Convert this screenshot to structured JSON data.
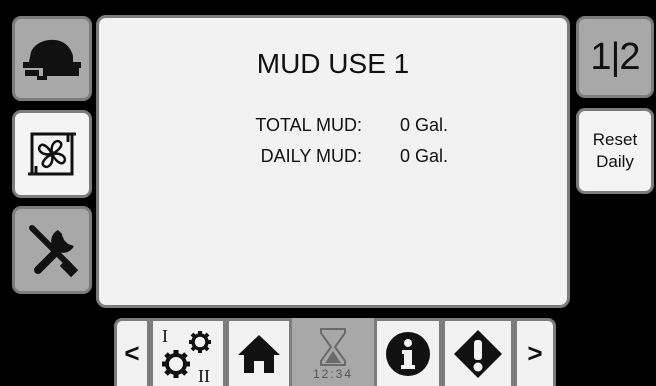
{
  "screen": {
    "title": "MUD USE 1",
    "rows": [
      {
        "label": "TOTAL MUD:",
        "value": "0 Gal."
      },
      {
        "label": "DAILY MUD:",
        "value": "0 Gal."
      }
    ]
  },
  "left_sidebar": {
    "items": [
      {
        "name": "machine-icon"
      },
      {
        "name": "fan-icon"
      },
      {
        "name": "tools-icon"
      }
    ]
  },
  "right_sidebar": {
    "page_indicator": "1|2",
    "reset_button": {
      "line1": "Reset",
      "line2": "Daily"
    }
  },
  "bottom_bar": {
    "prev": "<",
    "next": ">",
    "timer_text": "12:34",
    "icons": [
      "settings-icon",
      "home-icon",
      "hourglass-icon",
      "info-icon",
      "warning-icon"
    ],
    "settings_marks": [
      "I",
      "II"
    ]
  },
  "colors": {
    "panel": "#f2f2f2",
    "border": "#7c7c7c",
    "button_gray": "#a8a8a8",
    "background": "#000000"
  }
}
